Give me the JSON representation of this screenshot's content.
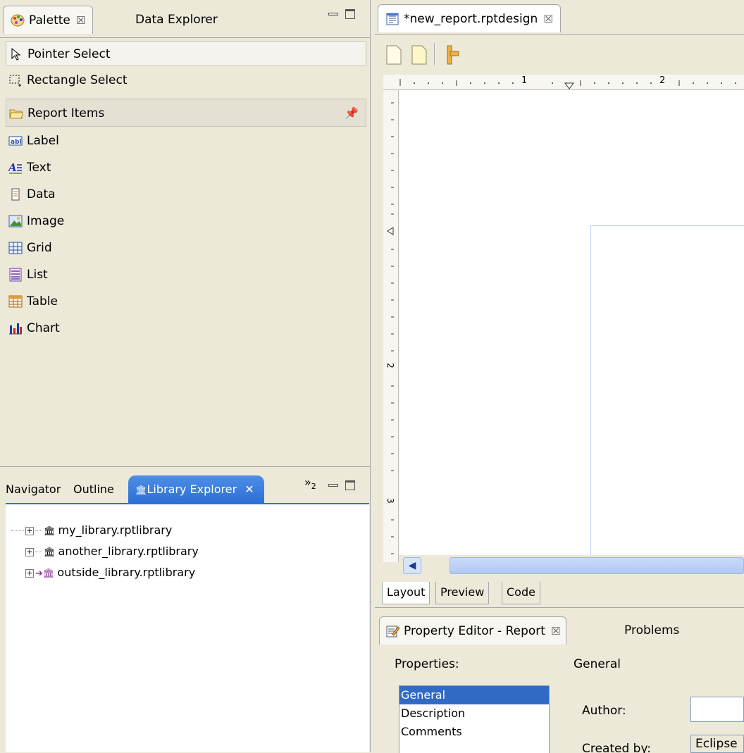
{
  "palette": {
    "tabs": [
      {
        "label": "Palette",
        "close": "☒"
      },
      {
        "label": "Data Explorer"
      }
    ],
    "tools": [
      "Pointer Select",
      "Rectangle Select"
    ],
    "drawer_label": "Report Items",
    "items": [
      "Label",
      "Text",
      "Data",
      "Image",
      "Grid",
      "List",
      "Table",
      "Chart"
    ]
  },
  "library": {
    "tabs": [
      "Navigator",
      "Outline",
      "Library Explorer"
    ],
    "close": "✕",
    "overflow": "»",
    "overflow_count": "2",
    "nodes": [
      "my_library.rptlibrary",
      "another_library.rptlibrary",
      "outside_library.rptlibrary"
    ]
  },
  "editor": {
    "tab_title": "*new_report.rptdesign",
    "tab_close": "☒",
    "ruler_h": [
      "1",
      "2"
    ],
    "ruler_v": [
      "2",
      "3"
    ],
    "bottom_tabs": [
      "Layout",
      "Preview",
      "Code"
    ]
  },
  "property": {
    "tabs": [
      "Property Editor - Report",
      "Problems"
    ],
    "close": "☒",
    "properties_label": "Properties:",
    "section_title": "General",
    "list": [
      "General",
      "Description",
      "Comments"
    ],
    "author_label": "Author:",
    "created_by_label": "Created by:",
    "created_by_value": "Eclipse"
  }
}
